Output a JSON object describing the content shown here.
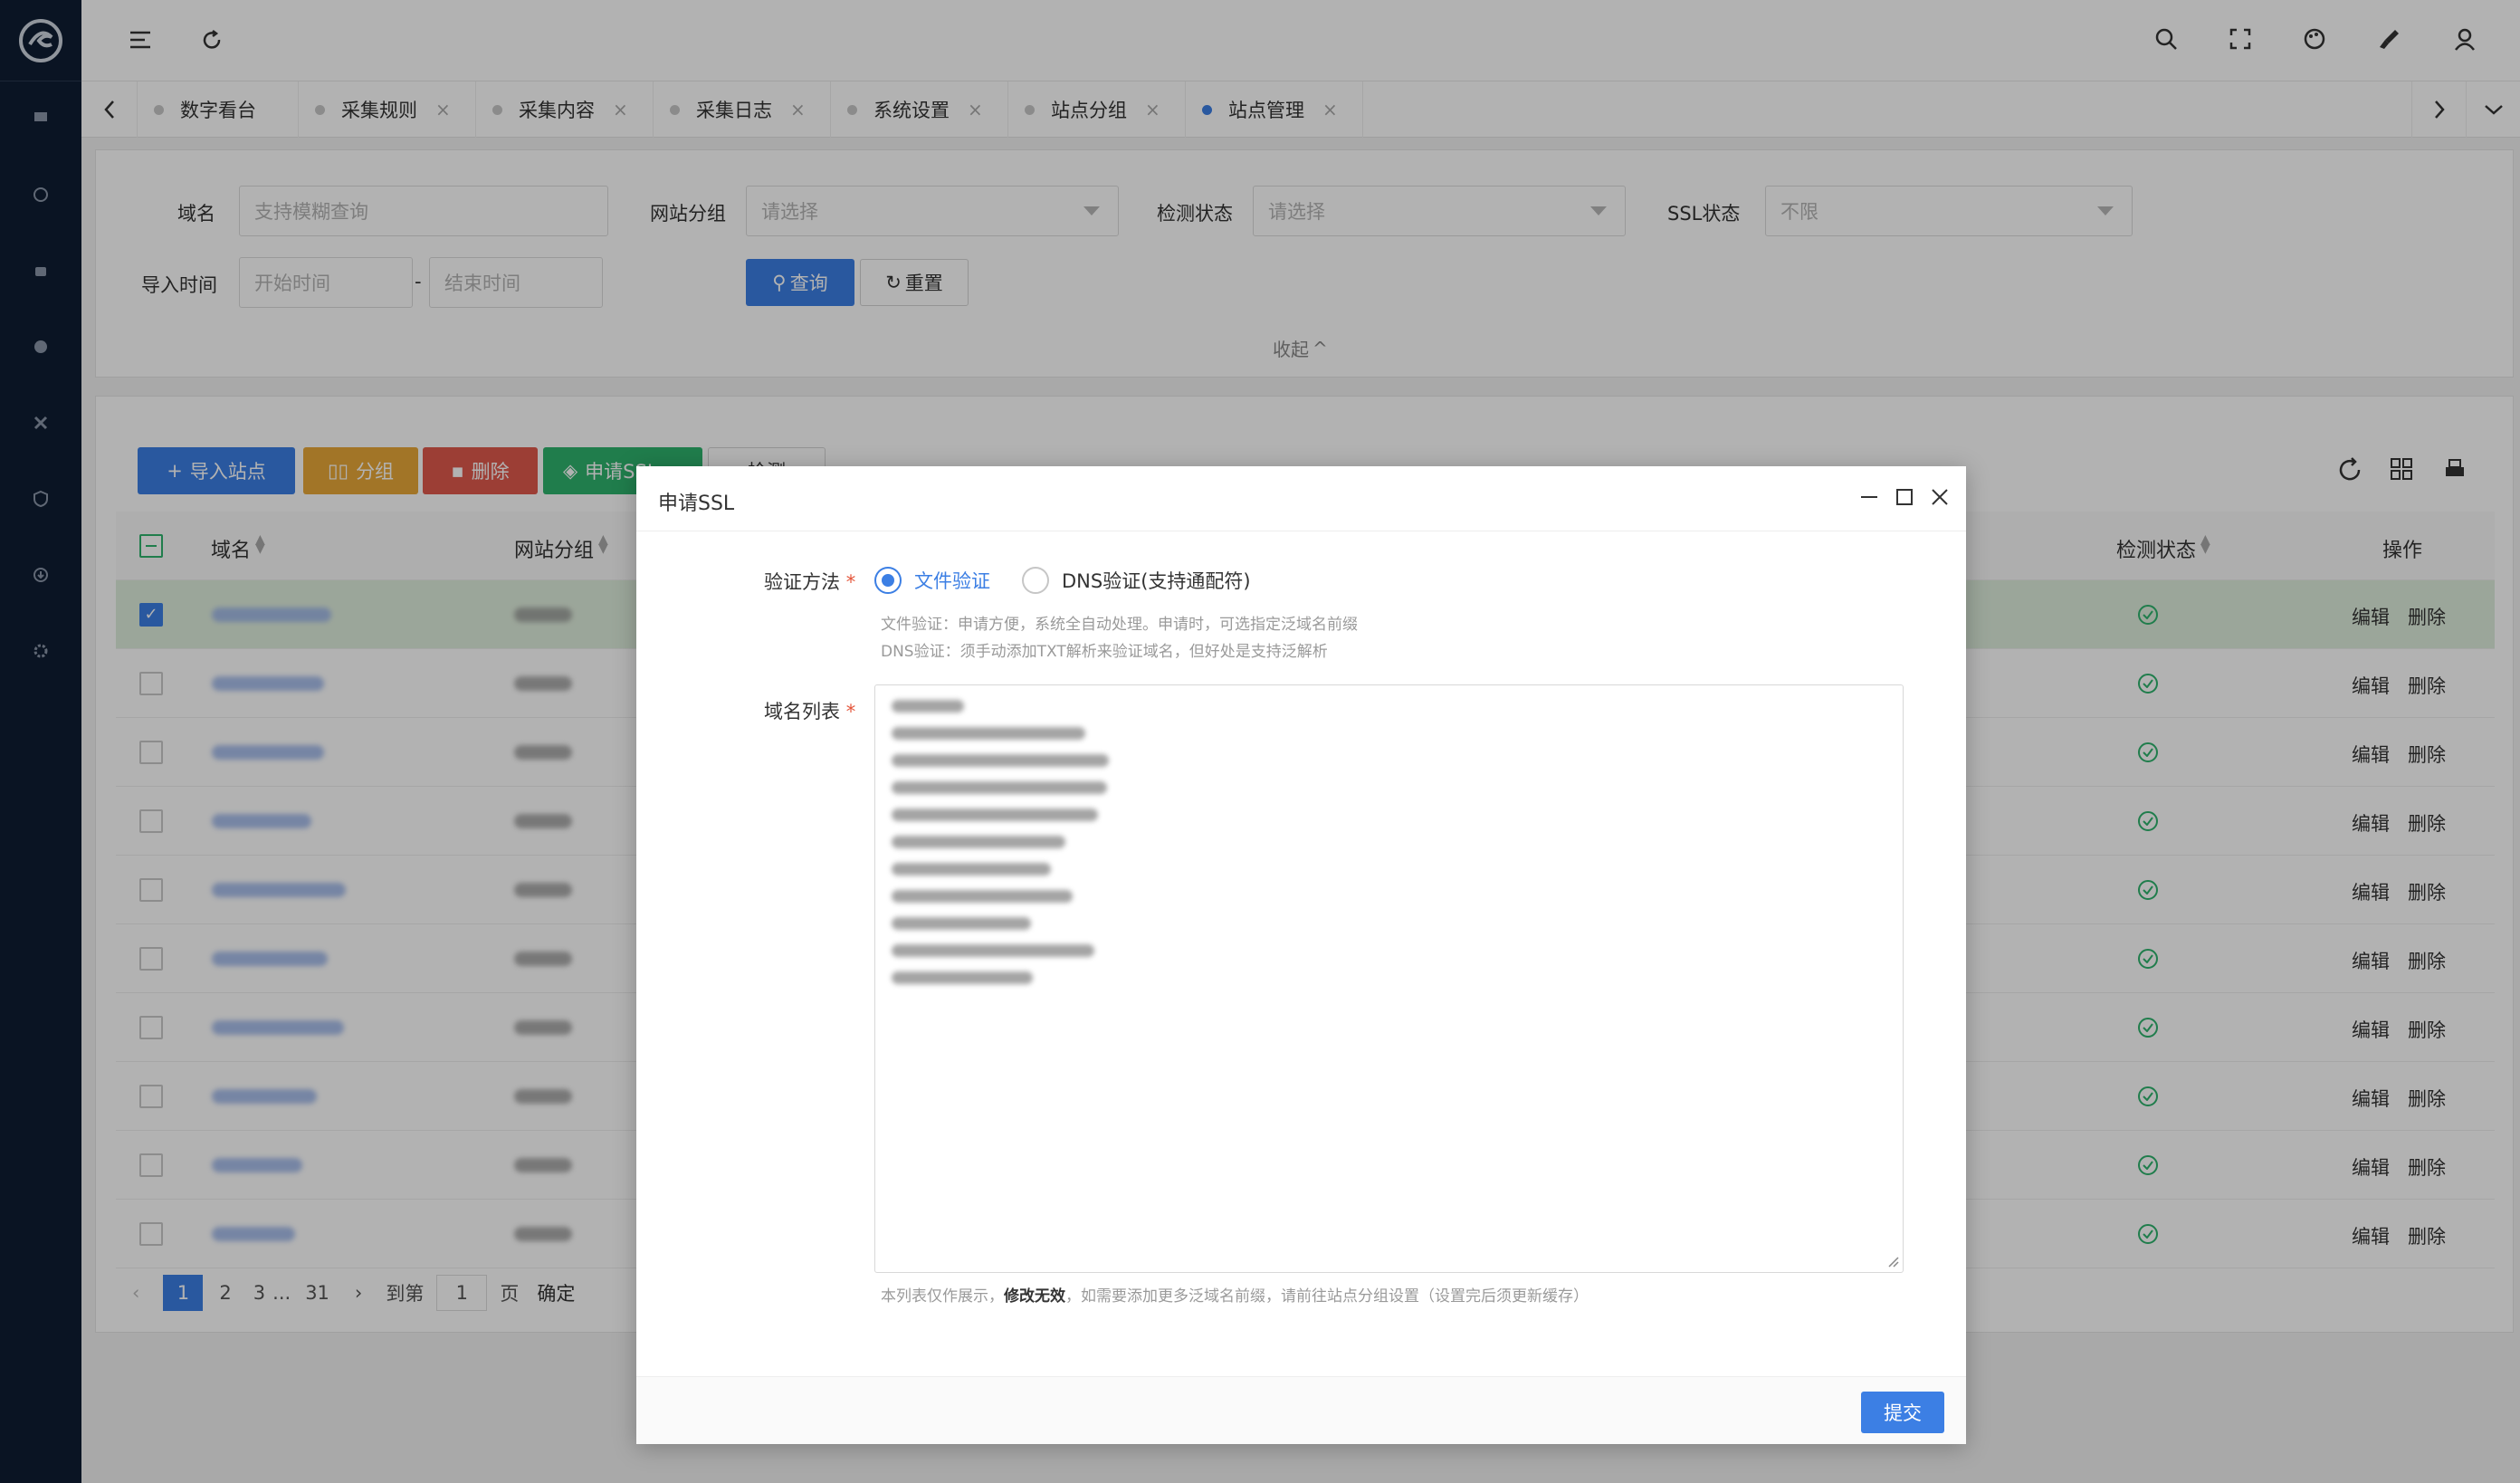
{
  "tabs": [
    {
      "label": "数字看台",
      "active": false,
      "closable": false
    },
    {
      "label": "采集规则",
      "active": false,
      "closable": true
    },
    {
      "label": "采集内容",
      "active": false,
      "closable": true
    },
    {
      "label": "采集日志",
      "active": false,
      "closable": true
    },
    {
      "label": "系统设置",
      "active": false,
      "closable": true
    },
    {
      "label": "站点分组",
      "active": false,
      "closable": true
    },
    {
      "label": "站点管理",
      "active": true,
      "closable": true
    }
  ],
  "filters": {
    "domain_label": "域名",
    "domain_placeholder": "支持模糊查询",
    "group_label": "网站分组",
    "group_placeholder": "请选择",
    "check_label": "检测状态",
    "check_placeholder": "请选择",
    "ssl_label": "SSL状态",
    "ssl_value": "不限",
    "import_label": "导入时间",
    "start_placeholder": "开始时间",
    "sep": "-",
    "end_placeholder": "结束时间",
    "query_btn": "查询",
    "reset_btn": "重置",
    "collapse": "收起"
  },
  "toolbar": {
    "import": "导入站点",
    "group": "分组",
    "delete": "删除",
    "ssl": "申请SSL",
    "check": "检测"
  },
  "table": {
    "headers": {
      "domain": "域名",
      "group": "网站分组",
      "check": "检测状态",
      "ops": "操作"
    },
    "edit": "编辑",
    "del": "删除"
  },
  "pagination": {
    "p1": "1",
    "p2": "2",
    "p3": "3",
    "ellipsis": "...",
    "last": "31",
    "goto": "到第",
    "page_value": "1",
    "page_unit": "页",
    "confirm": "确定"
  },
  "modal": {
    "title": "申请SSL",
    "verify_label": "验证方法",
    "opt_file": "文件验证",
    "opt_dns": "DNS验证(支持通配符)",
    "hint_file": "文件验证：申请方便，系统全自动处理。申请时，可选指定泛域名前缀",
    "hint_dns": "DNS验证：须手动添加TXT解析来验证域名，但好处是支持泛解析",
    "domains_label": "域名列表",
    "footer_note_a": "本列表仅作展示，",
    "footer_note_b": "修改无效",
    "footer_note_c": "，如需要添加更多泛域名前缀，请前往站点分组设置（设置完后须更新缓存）",
    "submit": "提交"
  },
  "colors": {
    "primary": "#3c7fe4",
    "warn": "#e8a838",
    "danger": "#e0594d",
    "success": "#2fb36d",
    "sidebar": "#0f1e33"
  }
}
